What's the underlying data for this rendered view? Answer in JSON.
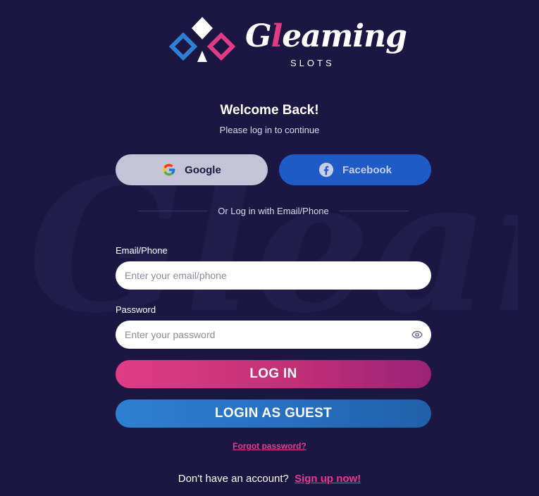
{
  "brand": {
    "name_prefix": "G",
    "name_accent": "l",
    "name_rest": "eaming",
    "subtitle": "SLOTS",
    "colors": {
      "pink": "#e03c86",
      "blue": "#2e7fd1",
      "white": "#ffffff",
      "background": "#1b1742"
    }
  },
  "heading": {
    "title": "Welcome Back!",
    "subtitle": "Please log in to continue"
  },
  "social": {
    "google_label": "Google",
    "google_icon": "google-icon",
    "facebook_label": "Facebook",
    "facebook_icon": "facebook-icon"
  },
  "divider_text": "Or Log in with Email/Phone",
  "form": {
    "email_label": "Email/Phone",
    "email_placeholder": "Enter your email/phone",
    "email_value": "",
    "password_label": "Password",
    "password_placeholder": "Enter your password",
    "password_value": "",
    "password_toggle_icon": "eye-icon"
  },
  "actions": {
    "login_label": "LOG IN",
    "guest_label": "LOGIN AS GUEST",
    "forgot_label": "Forgot password?"
  },
  "footer": {
    "prompt": "Don't have an account?",
    "signup_label": "Sign up now!"
  }
}
